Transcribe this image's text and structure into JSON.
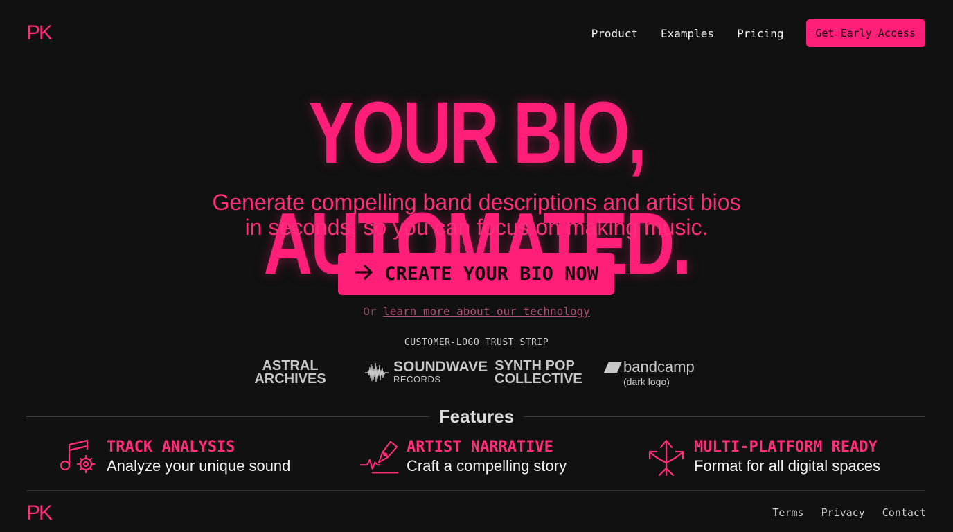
{
  "brand": {
    "logo_text": "PK"
  },
  "nav": {
    "items": [
      {
        "label": "Product"
      },
      {
        "label": "Examples"
      },
      {
        "label": "Pricing"
      }
    ],
    "cta_label": "Get Early Access"
  },
  "hero": {
    "title": "YOUR BIO, AUTOMATED.",
    "subtitle_line1": "Generate compelling band descriptions and artist bios",
    "subtitle_line2": "in seconds, so you can focus on making music.",
    "cta_label": "CREATE YOUR BIO NOW",
    "learn_prefix": "Or",
    "learn_link": "learn more about our technology"
  },
  "trust_strip": {
    "label": "CUSTOMER-LOGO TRUST STRIP",
    "logos": [
      {
        "line1": "ASTRAL",
        "line2": "ARCHIVES"
      },
      {
        "line1": "SOUNDWAVE",
        "line2": "RECORDS"
      },
      {
        "line1": "SYNTH POP",
        "line2": "COLLECTIVE"
      },
      {
        "line1": "bandcamp",
        "line2": "(dark logo)"
      }
    ]
  },
  "features": {
    "heading": "Features",
    "items": [
      {
        "title": "TRACK ANALYSIS",
        "desc": "Analyze your unique sound",
        "icon": "music-gear-icon"
      },
      {
        "title": "ARTIST NARRATIVE",
        "desc": "Craft a compelling story",
        "icon": "pen-waveform-icon"
      },
      {
        "title": "MULTI-PLATFORM READY",
        "desc": "Format for all digital spaces",
        "icon": "multi-arrow-icon"
      }
    ]
  },
  "footer": {
    "logo_text": "PK",
    "links": [
      {
        "label": "Terms"
      },
      {
        "label": "Privacy"
      },
      {
        "label": "Contact"
      }
    ]
  },
  "colors": {
    "accent": "#ff1f78",
    "background": "#111111"
  }
}
